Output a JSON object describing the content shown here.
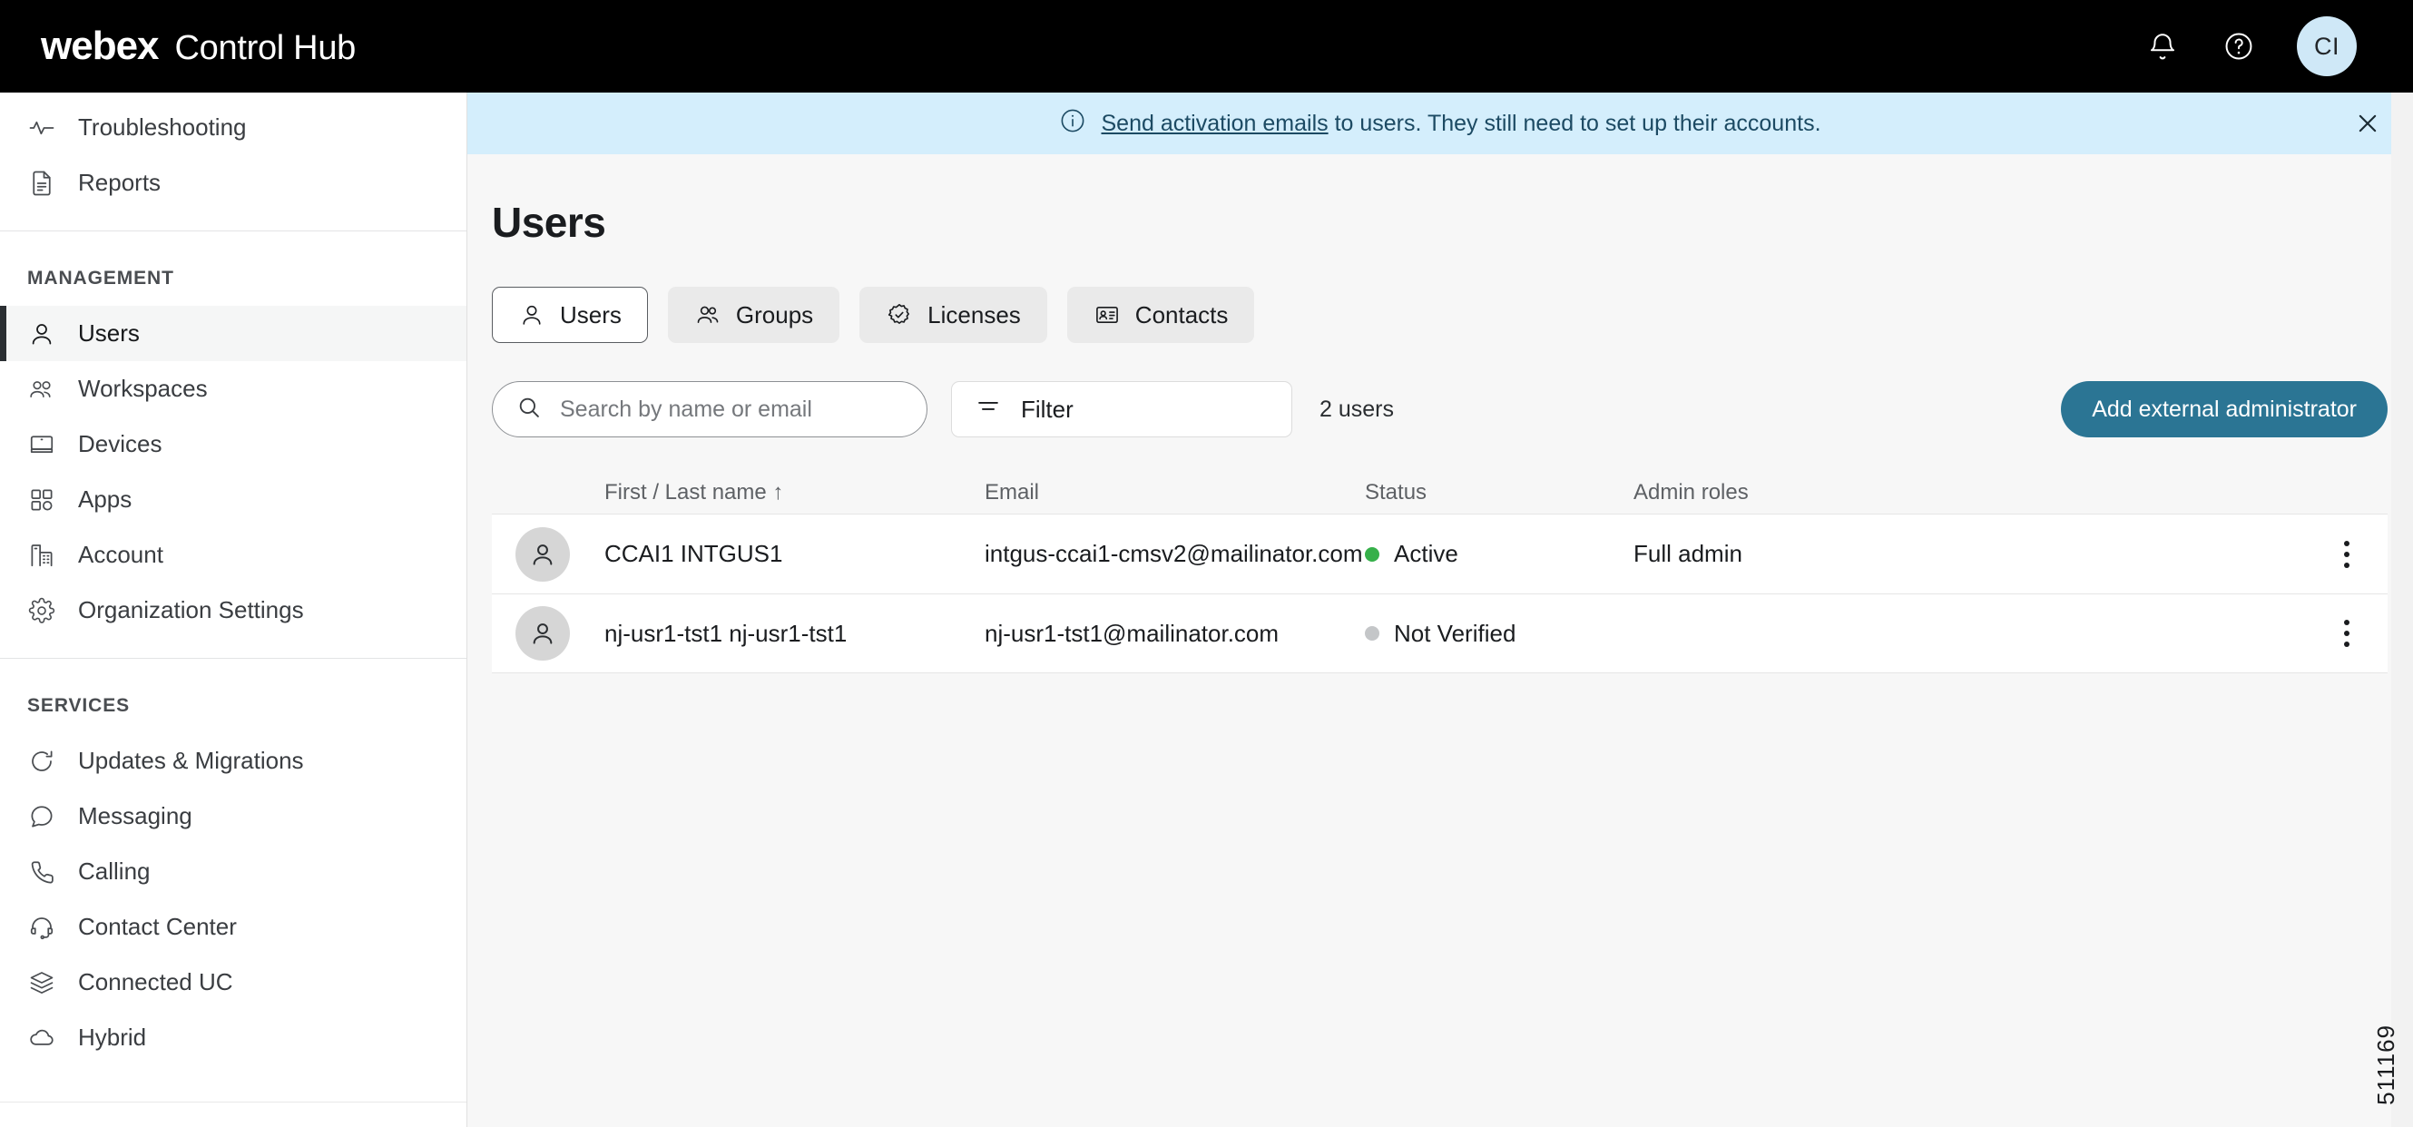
{
  "header": {
    "brand_primary": "webex",
    "brand_secondary": "Control Hub",
    "notifications_icon": "bell-icon",
    "help_icon": "help-circle-icon",
    "avatar_initials": "CI",
    "avatar_bg": "#cfe8f7",
    "bar_bg": "#000000"
  },
  "banner": {
    "info_icon": "info-circle-icon",
    "link_text": "Send activation emails",
    "rest_text": " to users. They still need to set up their accounts.",
    "close_icon": "close-icon",
    "bg": "#d4eefc",
    "text_color": "#1c4a63"
  },
  "sidebar": {
    "items_top": [
      {
        "label": "Troubleshooting",
        "icon": "pulse-icon"
      },
      {
        "label": "Reports",
        "icon": "document-report-icon"
      }
    ],
    "section_management": "MANAGEMENT",
    "items_management": [
      {
        "label": "Users",
        "icon": "person-icon",
        "active": true
      },
      {
        "label": "Workspaces",
        "icon": "people-group-icon",
        "active": false
      },
      {
        "label": "Devices",
        "icon": "monitor-icon",
        "active": false
      },
      {
        "label": "Apps",
        "icon": "grid-apps-icon",
        "active": false
      },
      {
        "label": "Account",
        "icon": "building-icon",
        "active": false
      },
      {
        "label": "Organization Settings",
        "icon": "gear-icon",
        "active": false
      }
    ],
    "section_services": "SERVICES",
    "items_services": [
      {
        "label": "Updates & Migrations",
        "icon": "refresh-icon"
      },
      {
        "label": "Messaging",
        "icon": "chat-bubble-icon"
      },
      {
        "label": "Calling",
        "icon": "phone-icon"
      },
      {
        "label": "Contact Center",
        "icon": "headset-icon"
      },
      {
        "label": "Connected UC",
        "icon": "layers-icon"
      },
      {
        "label": "Hybrid",
        "icon": "cloud-icon"
      }
    ]
  },
  "page": {
    "title": "Users"
  },
  "tabs": [
    {
      "label": "Users",
      "icon": "person-icon",
      "active": true
    },
    {
      "label": "Groups",
      "icon": "people-group-icon",
      "active": false
    },
    {
      "label": "Licenses",
      "icon": "badge-check-icon",
      "active": false
    },
    {
      "label": "Contacts",
      "icon": "id-card-icon",
      "active": false
    }
  ],
  "toolbar": {
    "search_placeholder": "Search by name or email",
    "search_value": "",
    "search_icon": "search-icon",
    "filter_label": "Filter",
    "filter_icon": "filter-lines-icon",
    "user_count": "2 users",
    "add_button_label": "Add external administrator",
    "add_button_color": "#2b7594"
  },
  "table": {
    "columns": [
      {
        "label": "First / Last name",
        "sort": "↑"
      },
      {
        "label": "Email"
      },
      {
        "label": "Status"
      },
      {
        "label": "Admin roles"
      }
    ],
    "rows": [
      {
        "avatar_icon": "person-avatar-icon",
        "name": "CCAI1 INTGUS1",
        "email": "intgus-ccai1-cmsv2@mailinator.com",
        "status": "Active",
        "status_color": "#36b04a",
        "roles": "Full admin",
        "menu_icon": "more-vertical-icon"
      },
      {
        "avatar_icon": "person-avatar-icon",
        "name": "nj-usr1-tst1 nj-usr1-tst1",
        "email": "nj-usr1-tst1@mailinator.com",
        "status": "Not Verified",
        "status_color": "#c4c6c8",
        "roles": "",
        "menu_icon": "more-vertical-icon"
      }
    ]
  },
  "watermark": "511169"
}
